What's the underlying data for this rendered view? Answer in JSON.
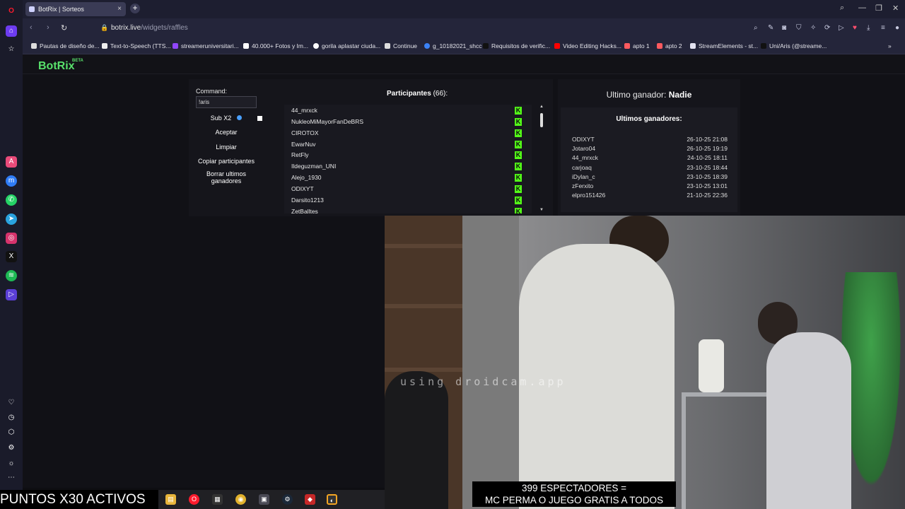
{
  "browser": {
    "tab_title": "BotRix | Sorteos",
    "tab_close": "×",
    "new_tab": "+",
    "url_domain": "botrix.live",
    "url_path": "/widgets/raffles"
  },
  "bookmarks": [
    "Pautas de diseño de...",
    "Text-to-Speech (TTS...",
    "streameruniversitari...",
    "40.000+ Fotos y Im...",
    "gorila aplastar ciuda...",
    "Continue",
    "g_10182021_shcc",
    "Requisitos de verific...",
    "Video Editing Hacks...",
    "apto 1",
    "apto 2",
    "StreamElements - st...",
    "Uni/Aris (@streame..."
  ],
  "bookmark_overflow": "»",
  "app": {
    "logo": "BotRix",
    "logo_badge": "BETA"
  },
  "raffle": {
    "command_label": "Command:",
    "command_value": "!aris",
    "sub_x2_label": "Sub X2",
    "accept_label": "Aceptar",
    "clear_label": "Limpiar",
    "copy_label": "Copiar participantes",
    "delete_winners_label": "Borrar ultimos ganadores",
    "participants_label": "Participantes",
    "participants_count": "(66):",
    "participants": [
      "44_mrxck",
      "NukleoMiMayorFanDeBRS",
      "CIROTOX",
      "EwarNuv",
      "RetFly",
      "Ildeguzman_UNI",
      "Alejo_1930",
      "ODIXYT",
      "Darsito1213",
      "ZetBalltes"
    ],
    "kick_badge": "K",
    "last_winner_label": "Ultimo ganador:",
    "last_winner_value": "Nadie",
    "last_winners_title": "Ultimos ganadores:",
    "last_winners": [
      {
        "name": "ODIXYT",
        "date": "26-10-25 21:08"
      },
      {
        "name": "Jotaro04",
        "date": "26-10-25 19:19"
      },
      {
        "name": "44_mrxck",
        "date": "24-10-25 18:11"
      },
      {
        "name": "carjoaq",
        "date": "23-10-25 18:44"
      },
      {
        "name": "iDylan_c",
        "date": "23-10-25 18:39"
      },
      {
        "name": "zFerxito",
        "date": "23-10-25 13:01"
      },
      {
        "name": "elpro151426",
        "date": "21-10-25 22:36"
      }
    ]
  },
  "stream_overlay": {
    "watermark": "using droidcam.app",
    "caption_line1": "399 ESPECTADORES =",
    "caption_line2": "MC PERMA O JUEGO GRATIS A TODOS",
    "puntos": "PUNTOS X30 ACTIVOS"
  },
  "colors": {
    "accent_green": "#58e06b",
    "kick_green": "#53fc18",
    "opera_red": "#ff1b2d"
  }
}
